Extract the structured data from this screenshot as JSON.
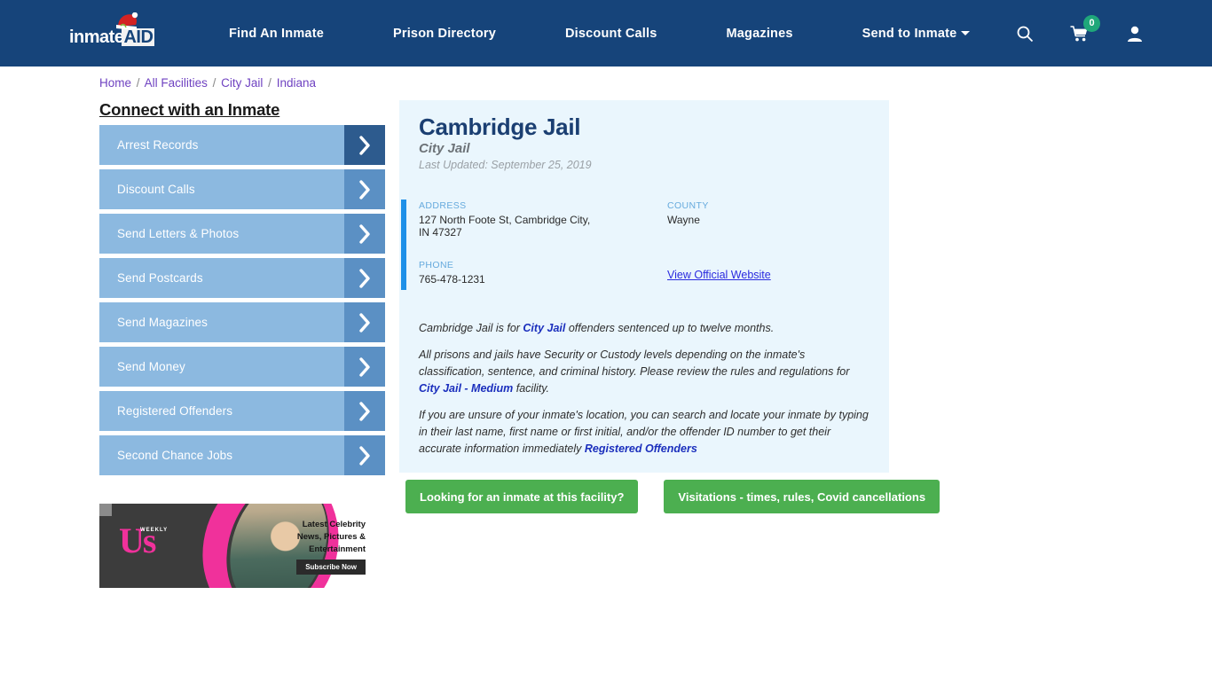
{
  "header": {
    "logo": {
      "part1": "inmate",
      "part2": "AID",
      "hat_icon": "santa-hat-icon"
    },
    "nav": [
      {
        "label": "Find An Inmate",
        "name": "find-an-inmate"
      },
      {
        "label": "Prison Directory",
        "name": "prison-directory"
      },
      {
        "label": "Discount Calls",
        "name": "discount-calls"
      },
      {
        "label": "Magazines",
        "name": "magazines"
      },
      {
        "label": "Send to Inmate",
        "name": "send-to-inmate",
        "has_caret": true
      }
    ],
    "icons": {
      "search": "search-icon",
      "cart": "shopping-cart-icon",
      "cart_count": "0",
      "account": "user-account-icon"
    },
    "colors": {
      "bar": "#16447a",
      "cart_badge": "#1fa77a"
    }
  },
  "breadcrumb": {
    "items": [
      "Home",
      "All Facilities",
      "City Jail",
      "Indiana"
    ],
    "separator": "/"
  },
  "sidebar": {
    "title": "Connect with an Inmate",
    "items": [
      {
        "label": "Arrest Records",
        "active": true
      },
      {
        "label": "Discount Calls",
        "active": false
      },
      {
        "label": "Send Letters & Photos",
        "active": false
      },
      {
        "label": "Send Postcards",
        "active": false
      },
      {
        "label": "Send Magazines",
        "active": false
      },
      {
        "label": "Send Money",
        "active": false
      },
      {
        "label": "Registered Offenders",
        "active": false
      },
      {
        "label": "Second Chance Jobs",
        "active": false
      }
    ],
    "colors": {
      "button": "#8cb9e0",
      "arrow": "#5b90c4",
      "arrow_active": "#2d5b8e"
    }
  },
  "ad": {
    "brand": "Us",
    "brand_sub": "WEEKLY",
    "headline": "Latest Celebrity News, Pictures & Entertainment",
    "cta": "Subscribe Now"
  },
  "facility": {
    "name": "Cambridge Jail",
    "type": "City Jail",
    "last_updated": "Last Updated: September 25, 2019",
    "fields": {
      "address_label": "ADDRESS",
      "address_value": "127 North Foote St, Cambridge City, IN 47327",
      "county_label": "COUNTY",
      "county_value": "Wayne",
      "phone_label": "PHONE",
      "phone_value": "765-478-1231",
      "website_link": "View Official Website"
    },
    "paragraphs": {
      "p1_a": "Cambridge Jail is for ",
      "p1_link": "City Jail",
      "p1_b": " offenders sentenced up to twelve months.",
      "p2_a": "All prisons and jails have Security or Custody levels depending on the inmate's classification, sentence, and criminal history. Please review the rules and regulations for ",
      "p2_link": "City Jail - Medium",
      "p2_b": " facility.",
      "p3_a": "If you are unsure of your inmate's location, you can search and locate your inmate by typing in their last name, first name or first initial, and/or the offender ID number to get their accurate information immediately ",
      "p3_link": "Registered Offenders"
    }
  },
  "actions": {
    "inmate_search": "Looking for an inmate at this facility?",
    "visitations": "Visitations - times, rules, Covid cancellations",
    "color": "#4caf50"
  }
}
